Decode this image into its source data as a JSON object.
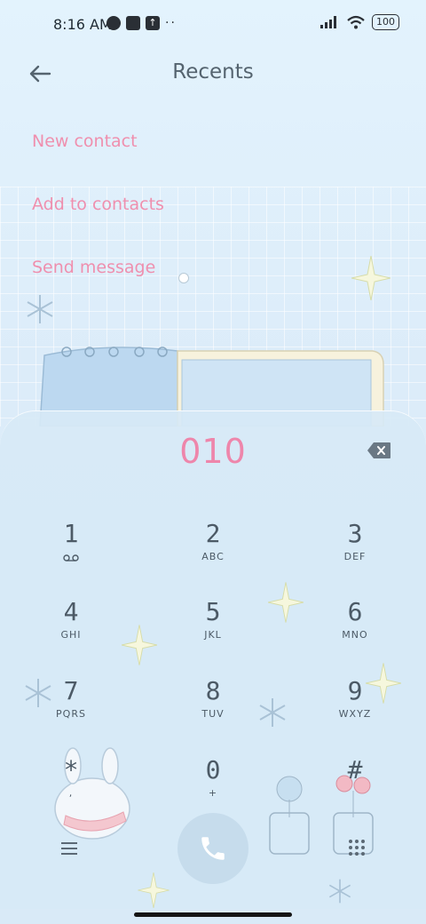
{
  "status_bar": {
    "time": "8:16 AM",
    "battery": "100",
    "icons": [
      "data-saver-icon",
      "notification-icon",
      "upload-icon",
      "more-dots-icon",
      "signal-icon",
      "wifi-icon",
      "battery-icon"
    ]
  },
  "header": {
    "title": "Recents",
    "back_icon": "arrow-left-icon"
  },
  "menu": {
    "items": [
      {
        "label": "New contact"
      },
      {
        "label": "Add to contacts"
      },
      {
        "label": "Send message"
      }
    ]
  },
  "dialer": {
    "number": "010",
    "keys": [
      {
        "digit": "1",
        "letters": ""
      },
      {
        "digit": "2",
        "letters": "ABC"
      },
      {
        "digit": "3",
        "letters": "DEF"
      },
      {
        "digit": "4",
        "letters": "GHI"
      },
      {
        "digit": "5",
        "letters": "JKL"
      },
      {
        "digit": "6",
        "letters": "MNO"
      },
      {
        "digit": "7",
        "letters": "PQRS"
      },
      {
        "digit": "8",
        "letters": "TUV"
      },
      {
        "digit": "9",
        "letters": "WXYZ"
      },
      {
        "digit": "*",
        "letters": ","
      },
      {
        "digit": "0",
        "letters": "+"
      },
      {
        "digit": "#",
        "letters": ""
      }
    ]
  },
  "colors": {
    "accent": "#ee86ab",
    "sheet": "#d7e9f6",
    "call_button": "#c6dcec"
  }
}
